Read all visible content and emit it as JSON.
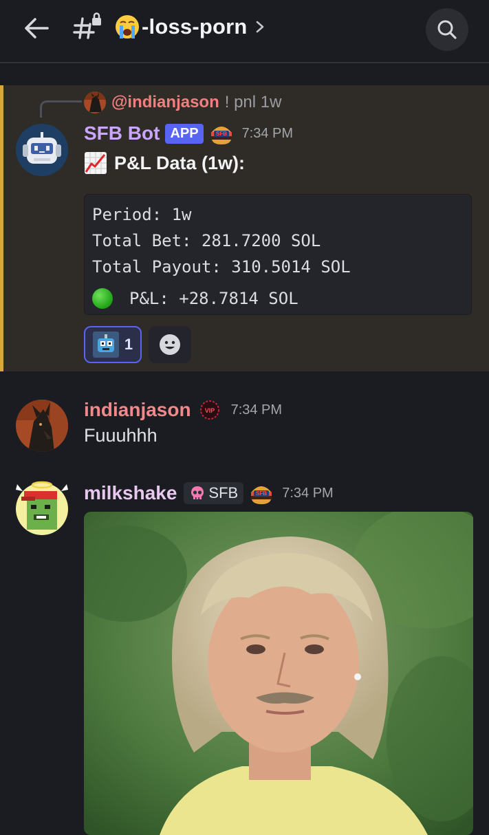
{
  "header": {
    "back_icon": "arrow-left-icon",
    "channel_icon": "locked-hash-icon",
    "channel_emoji": "crying-face-icon",
    "channel_name": "-loss-porn",
    "chevron_icon": "chevron-right-icon",
    "search_icon": "search-icon"
  },
  "messages": [
    {
      "reply": {
        "mention": "@indianjason",
        "text": "! pnl 1w"
      },
      "author": "SFB Bot",
      "author_color": "#c9a7ff",
      "badge": "APP",
      "time": "7:34 PM",
      "title": "P&L Data (1w):",
      "code_lines": [
        "Period: 1w",
        "Total Bet: 281.7200 SOL",
        "Total Payout: 310.5014 SOL",
        "P&L: +28.7814 SOL"
      ],
      "reactions": [
        {
          "emoji": "robot-pixel-icon",
          "count": "1"
        }
      ],
      "add_reaction_icon": "smiley-add-icon",
      "highlight_color": "#d8a63a"
    },
    {
      "author": "indianjason",
      "author_color": "#f08a8a",
      "role_icon": "vip-badge-icon",
      "time": "7:34 PM",
      "text": "Fuuuhhh"
    },
    {
      "author": "milkshake",
      "author_color": "#e8c8ee",
      "tag": "SFB",
      "tag_icon": "pink-skull-icon",
      "time": "7:34 PM",
      "attachment": "gif-image"
    }
  ],
  "colors": {
    "background": "#1b1c21",
    "accent": "#5865f2",
    "mention": "#f08080"
  }
}
